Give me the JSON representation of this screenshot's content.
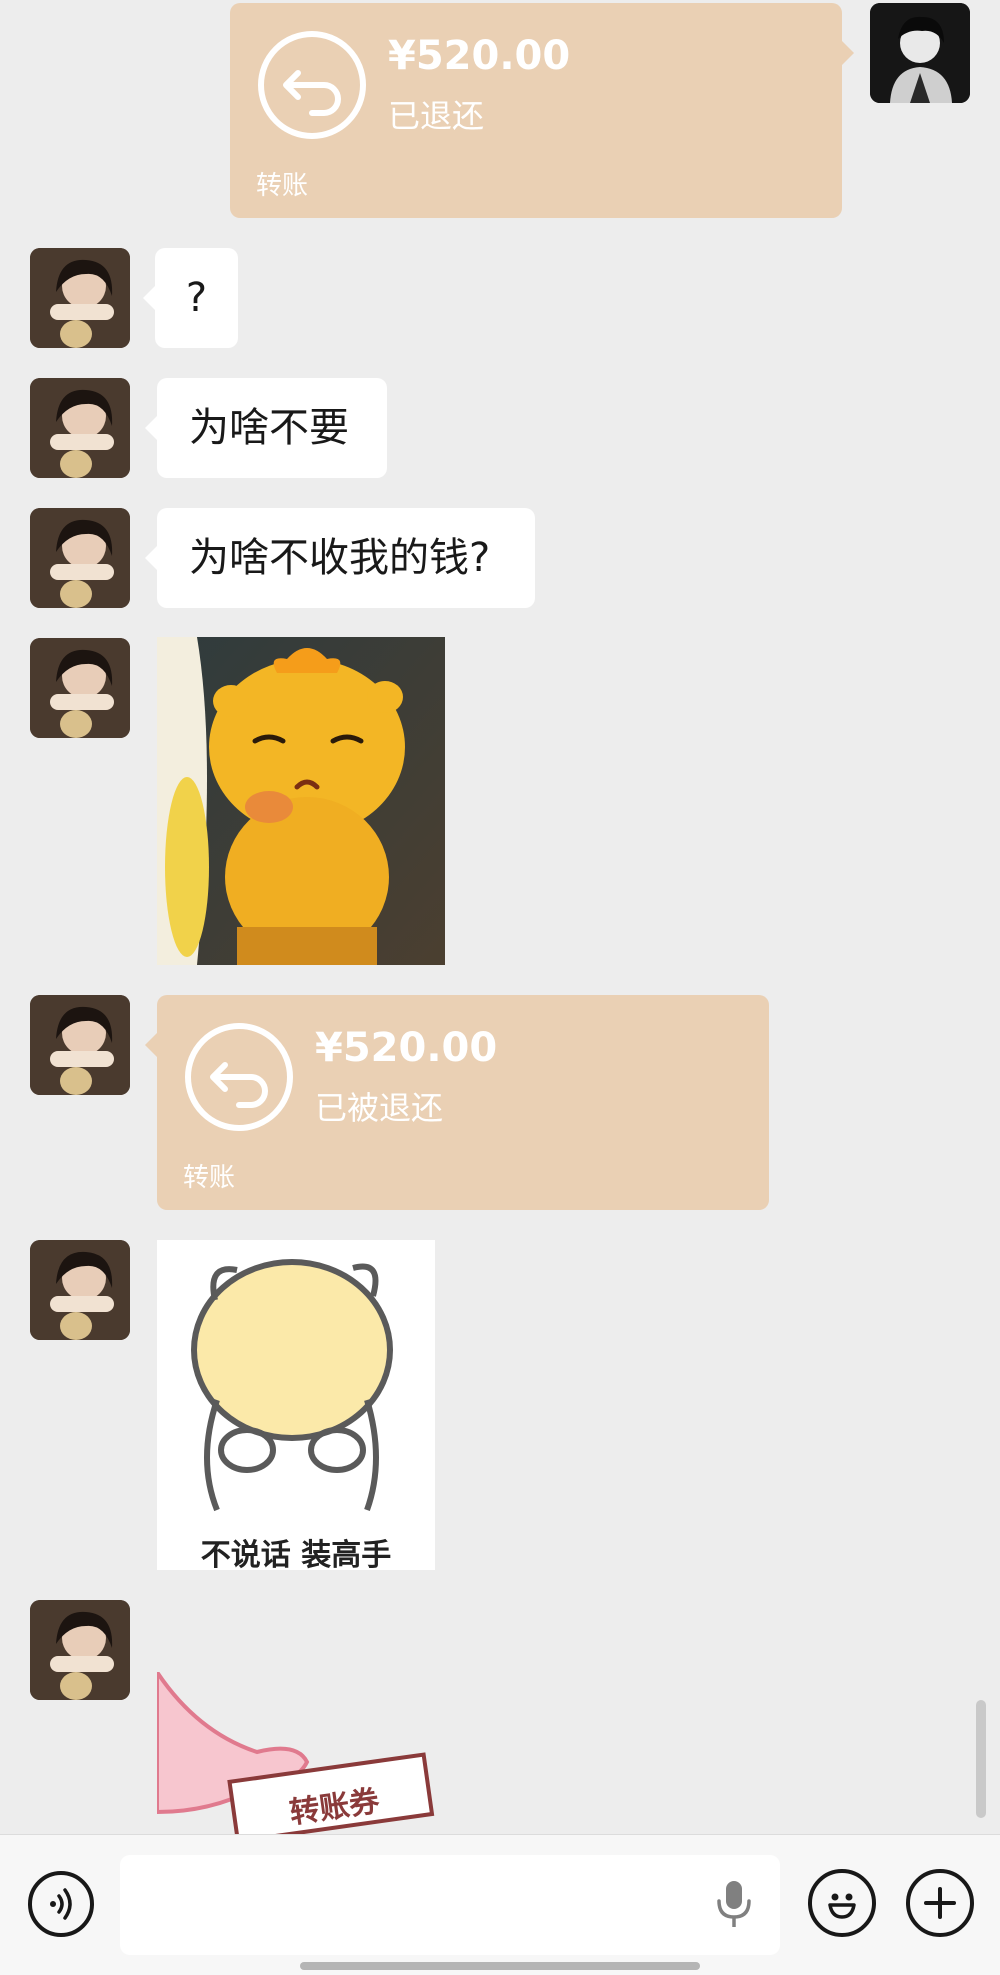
{
  "chat": {
    "messages": [
      {
        "type": "transfer",
        "sender": "me",
        "amount": "¥520.00",
        "status": "已退还",
        "label": "转账",
        "icon": "refund-arrow-icon"
      },
      {
        "type": "text",
        "sender": "her",
        "text": "?"
      },
      {
        "type": "text",
        "sender": "her",
        "text": "为啥不要"
      },
      {
        "type": "text",
        "sender": "her",
        "text": "为啥不收我的钱?"
      },
      {
        "type": "sticker",
        "sender": "her",
        "description": "yellow-chick-sticker"
      },
      {
        "type": "transfer",
        "sender": "her",
        "amount": "¥520.00",
        "status": "已被退还",
        "label": "转账",
        "icon": "refund-arrow-icon"
      },
      {
        "type": "sticker",
        "sender": "her",
        "caption": "不说话 装高手"
      },
      {
        "type": "sticker",
        "sender": "her",
        "caption": "转账券"
      }
    ]
  },
  "input_bar": {
    "voice_icon": "voice-mode-icon",
    "mic_icon": "microphone-icon",
    "emoji_icon": "emoji-icon",
    "plus_icon": "plus-icon",
    "value": ""
  },
  "colors": {
    "background": "#ededed",
    "transfer_card": "#ead0b4",
    "bubble": "#ffffff"
  }
}
